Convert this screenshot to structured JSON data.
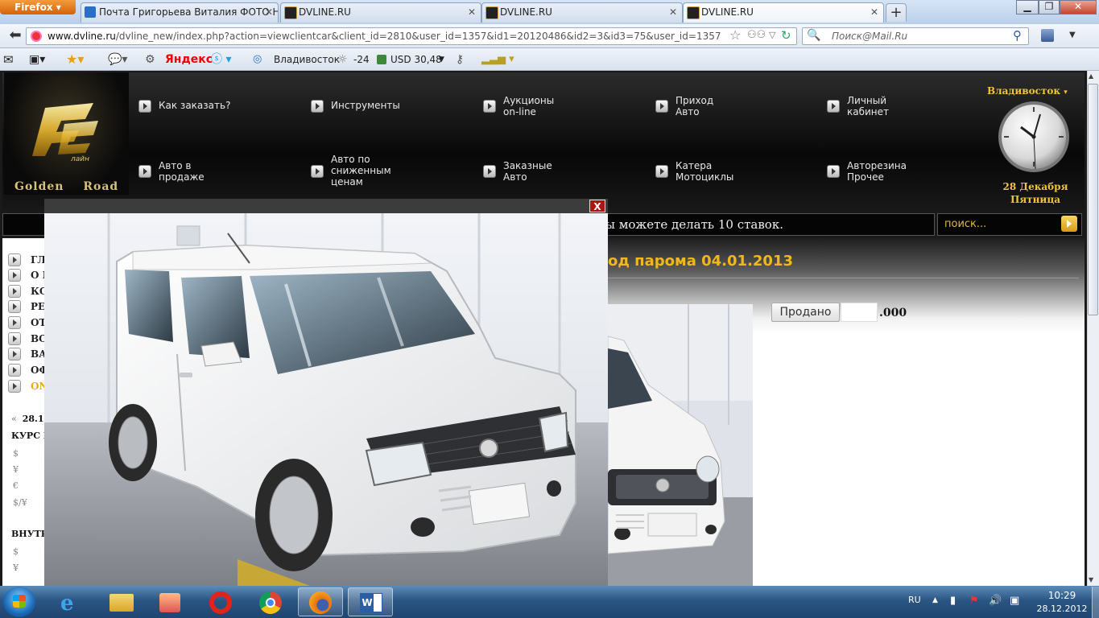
{
  "browser": {
    "app_button": "Firefox",
    "tabs": [
      {
        "title": "Почта Григорьева Виталия ФОТО Н...",
        "active": false
      },
      {
        "title": "DVLINE.RU",
        "active": false
      },
      {
        "title": "DVLINE.RU",
        "active": false
      },
      {
        "title": "DVLINE.RU",
        "active": true
      }
    ],
    "url_domain": "www.dvline.ru",
    "url_path": "/dvline_new/index.php?action=viewclientcar&client_id=2810&user_id=1357&id1=20120486&id2=3&id3=75&user_id=1357",
    "search_placeholder": "Поиск@Mail.Ru",
    "toolbar": {
      "yandex": "Яндекс",
      "city": "Владивосток",
      "temp": "-24",
      "usd": "USD 30,48"
    }
  },
  "site": {
    "logo_text": "Golden Road",
    "menu_row1": [
      "Как заказать?",
      "Инструменты",
      "Аукционы\non-line",
      "Приход\nАвто",
      "Личный\nкабинет"
    ],
    "menu_row2": [
      "Авто в\nпродаже",
      "Авто по\nсниженным\nценам",
      "Заказные\nАвто",
      "Катера\nМотоциклы",
      "Авторезина\nПрочее"
    ],
    "city": "Владивосток",
    "date_line1": "28 Декабря",
    "date_line2": "Пятница",
    "ticker": "ы можете делать 10 ставок.",
    "search_placeholder": "поиск...",
    "left_menu": [
      "ГЛ",
      "О К",
      "КО",
      "РЕ",
      "ОТ",
      "ВО",
      "ВА",
      "ОФ",
      "ON"
    ],
    "side_date": "28.1",
    "side_rates_title": "КУРС В",
    "side_currencies": [
      "$",
      "¥",
      "€",
      "$/¥"
    ],
    "side_internal_title": "ВНУТР",
    "side_internal_currencies": [
      "$",
      "¥"
    ],
    "heading": "од парома 04.01.2013",
    "sold_button": "Продано",
    "price_suffix": ".000"
  },
  "lightbox": {
    "close_label": "X"
  },
  "taskbar": {
    "lang": "RU",
    "time": "10:29",
    "date": "28.12.2012"
  },
  "colors": {
    "accent_gold": "#f0b81c",
    "header_black": "#0a0a0a",
    "close_red": "#b31212"
  }
}
